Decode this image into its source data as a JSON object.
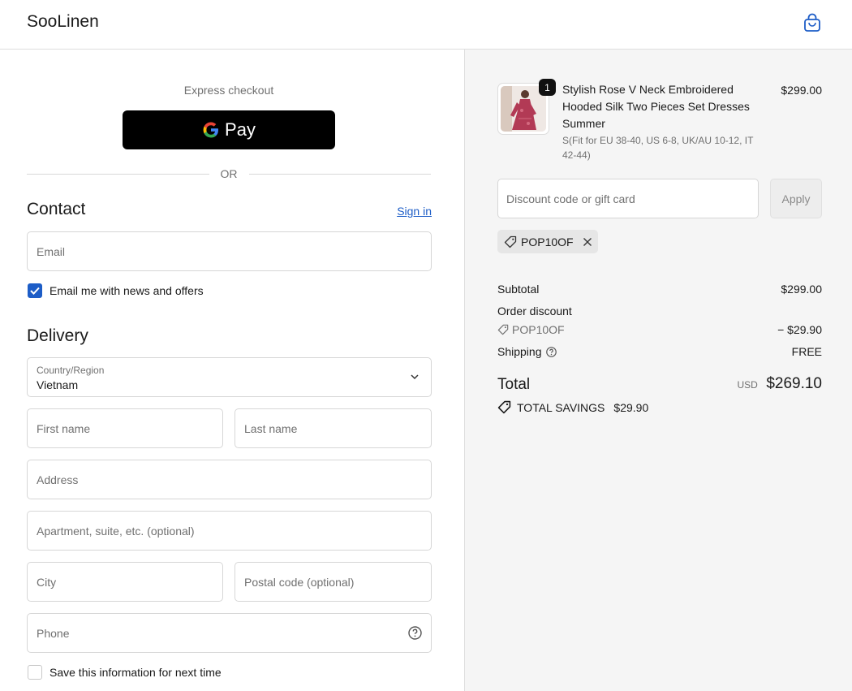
{
  "brand": "SooLinen",
  "express": {
    "label": "Express checkout",
    "gpay_label": "Pay",
    "divider": "OR"
  },
  "contact": {
    "title": "Contact",
    "signin": "Sign in",
    "email_placeholder": "Email",
    "newsletter_label": "Email me with news and offers",
    "newsletter_checked": true
  },
  "delivery": {
    "title": "Delivery",
    "country_label": "Country/Region",
    "country_value": "Vietnam",
    "first_name_placeholder": "First name",
    "last_name_placeholder": "Last name",
    "address_placeholder": "Address",
    "apartment_placeholder": "Apartment, suite, etc. (optional)",
    "city_placeholder": "City",
    "postal_placeholder": "Postal code (optional)",
    "phone_placeholder": "Phone",
    "save_info_label": "Save this information for next time",
    "save_info_checked": false
  },
  "summary": {
    "product": {
      "name": "Stylish Rose V Neck Embroidered Hooded Silk Two Pieces Set Dresses Summer",
      "variant": "S(Fit for EU 38-40, US 6-8, UK/AU 10-12, IT 42-44)",
      "price": "$299.00",
      "quantity": "1"
    },
    "discount_placeholder": "Discount code or gift card",
    "apply_label": "Apply",
    "applied_code": "POP10OF",
    "subtotal_label": "Subtotal",
    "subtotal_value": "$299.00",
    "order_discount_label": "Order discount",
    "discount_code": "POP10OF",
    "discount_value": "− $29.90",
    "shipping_label": "Shipping",
    "shipping_value": "FREE",
    "total_label": "Total",
    "total_currency": "USD",
    "total_value": "$269.10",
    "savings_label": "TOTAL SAVINGS",
    "savings_value": "$29.90"
  },
  "colors": {
    "accent": "#1d5dc7",
    "button_dark": "#000000",
    "summary_bg": "#f5f5f5"
  }
}
